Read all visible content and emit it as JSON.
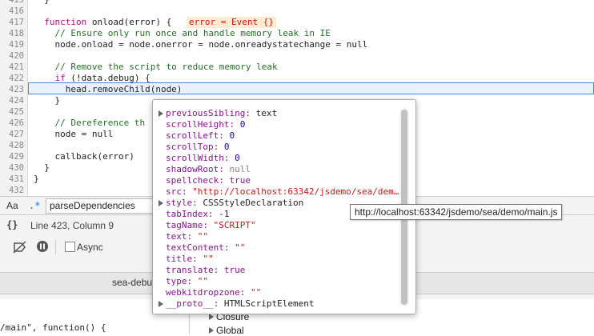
{
  "editor": {
    "lines": [
      {
        "num": "415",
        "code": "  }"
      },
      {
        "num": "416",
        "code": ""
      },
      {
        "num": "417",
        "code": "  function onload(error) {",
        "inline": "error = Event {}"
      },
      {
        "num": "418",
        "code": "    // Ensure only run once and handle memory leak in IE"
      },
      {
        "num": "419",
        "code": "    node.onload = node.onerror = node.onreadystatechange = null"
      },
      {
        "num": "420",
        "code": ""
      },
      {
        "num": "421",
        "code": "    // Remove the script to reduce memory leak"
      },
      {
        "num": "422",
        "code": "    if (!data.debug) {"
      },
      {
        "num": "423",
        "code": "      head.removeChild(node)"
      },
      {
        "num": "424",
        "code": "    }"
      },
      {
        "num": "425",
        "code": ""
      },
      {
        "num": "426",
        "code": "    // Dereference th"
      },
      {
        "num": "427",
        "code": "    node = null"
      },
      {
        "num": "428",
        "code": ""
      },
      {
        "num": "429",
        "code": "    callback(error)"
      },
      {
        "num": "430",
        "code": "  }"
      },
      {
        "num": "431",
        "code": "}"
      },
      {
        "num": "432",
        "code": ""
      }
    ]
  },
  "search": {
    "case_label": "Aa",
    "regex_label": ".*",
    "value": "parseDependencies"
  },
  "status": {
    "braces": "{}",
    "position": "Line 423, Column 9"
  },
  "toolbar": {
    "async_label": "Async"
  },
  "tabs": {
    "file_tab": "sea-debu"
  },
  "bottom": {
    "code": "/main\", function() {"
  },
  "scope": {
    "closure": "Closure",
    "global": "Global"
  },
  "popover": {
    "props": [
      {
        "name": "previousSibling",
        "value": "text",
        "kind": "plain",
        "expandable": true
      },
      {
        "name": "scrollHeight",
        "value": "0",
        "kind": "num"
      },
      {
        "name": "scrollLeft",
        "value": "0",
        "kind": "num"
      },
      {
        "name": "scrollTop",
        "value": "0",
        "kind": "num"
      },
      {
        "name": "scrollWidth",
        "value": "0",
        "kind": "num"
      },
      {
        "name": "shadowRoot",
        "value": "null",
        "kind": "null"
      },
      {
        "name": "spellcheck",
        "value": "true",
        "kind": "kw"
      },
      {
        "name": "src",
        "value": "\"http://localhost:63342/jsdemo/sea/dem…",
        "kind": "str"
      },
      {
        "name": "style",
        "value": "CSSStyleDeclaration",
        "kind": "plain",
        "expandable": true
      },
      {
        "name": "tabIndex",
        "value": "-1",
        "kind": "num"
      },
      {
        "name": "tagName",
        "value": "\"SCRIPT\"",
        "kind": "str"
      },
      {
        "name": "text",
        "value": "\"\"",
        "kind": "str"
      },
      {
        "name": "textContent",
        "value": "\"\"",
        "kind": "str"
      },
      {
        "name": "title",
        "value": "\"\"",
        "kind": "str"
      },
      {
        "name": "translate",
        "value": "true",
        "kind": "kw"
      },
      {
        "name": "type",
        "value": "\"\"",
        "kind": "str"
      },
      {
        "name": "webkitdropzone",
        "value": "\"\"",
        "kind": "str"
      },
      {
        "name": "__proto__",
        "value": "HTMLScriptElement",
        "kind": "plain",
        "expandable": true
      }
    ]
  },
  "tooltip": {
    "text": "http://localhost:63342/jsdemo/sea/demo/main.js"
  }
}
